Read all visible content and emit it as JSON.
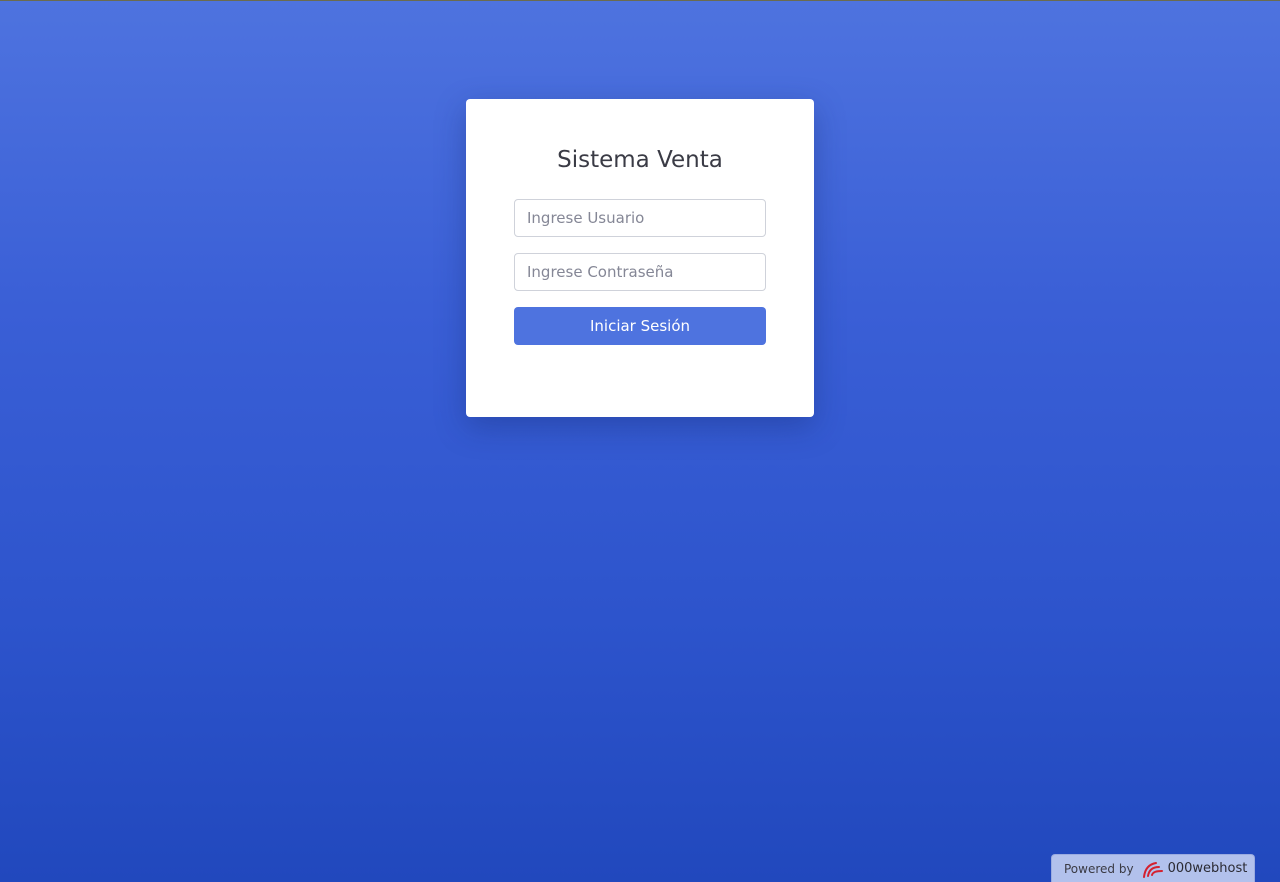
{
  "login": {
    "title": "Sistema Venta",
    "user_placeholder": "Ingrese Usuario",
    "password_placeholder": "Ingrese Contraseña",
    "submit_label": "Iniciar Sesión"
  },
  "footer_badge": {
    "powered_by": "Powered by",
    "brand": "000webhost",
    "icon": "000webhost-logo-icon"
  },
  "colors": {
    "background_top": "#4e73df",
    "background_bottom": "#2148bd",
    "button": "#4e73df",
    "card": "#ffffff"
  }
}
